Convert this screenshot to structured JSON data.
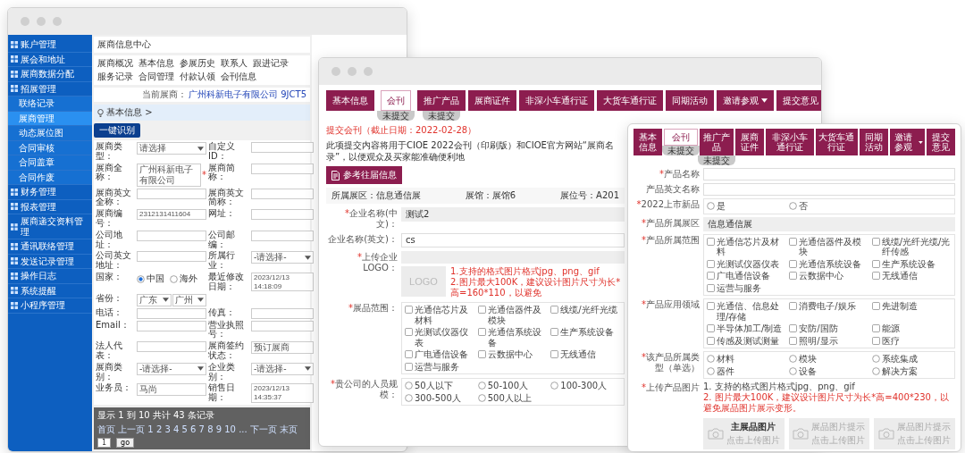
{
  "admin_window": {
    "sidebar": [
      {
        "label": "账户管理",
        "selected": false
      },
      {
        "label": "展会和地址",
        "selected": false
      },
      {
        "label": "展商数据分配",
        "selected": false
      },
      {
        "label": "招展管理",
        "selected": false,
        "children": [
          {
            "label": "联络记录",
            "selected": false
          },
          {
            "label": "展商管理",
            "selected": true
          },
          {
            "label": "动态展位图",
            "selected": false
          },
          {
            "label": "合同审核",
            "selected": false
          },
          {
            "label": "合同盖章",
            "selected": false
          },
          {
            "label": "合同作废",
            "selected": false
          }
        ]
      },
      {
        "label": "财务管理",
        "selected": false
      },
      {
        "label": "报表管理",
        "selected": false
      },
      {
        "label": "展商递交资料管理",
        "selected": false
      },
      {
        "label": "通讯联络管理",
        "selected": false
      },
      {
        "label": "发送记录管理",
        "selected": false
      },
      {
        "label": "操作日志",
        "selected": false
      },
      {
        "label": "系统提醒",
        "selected": false
      },
      {
        "label": "小程序管理",
        "selected": false
      }
    ],
    "page_title": "展商信息中心",
    "nav_links": [
      "展商概况",
      "基本信息",
      "参展历史",
      "联系人",
      "跟进记录",
      "服务记录",
      "合同管理",
      "付款认领",
      "会刊信息"
    ],
    "current_label": "当前展商：",
    "current_exhibitor": "广州科新电子有限公司 9JCT5",
    "breadcrumb": "基本信息 >",
    "action_button": "一键识别",
    "fields": [
      {
        "kind": "select",
        "label": "展商类型：",
        "value": "请选择"
      },
      {
        "kind": "input",
        "label": "自定义ID："
      },
      {
        "kind": "input",
        "label": "展商全称：",
        "value": "广州科新电子有限公司",
        "mark": "*"
      },
      {
        "kind": "input",
        "label": "展商简称："
      },
      {
        "kind": "input",
        "label": "展商英文全称："
      },
      {
        "kind": "input",
        "label": "展商英文简称："
      },
      {
        "kind": "input",
        "label": "展商编号：",
        "value": "2312131411604"
      },
      {
        "kind": "input",
        "label": "网址："
      },
      {
        "kind": "input",
        "label": "公司地址："
      },
      {
        "kind": "input",
        "label": "公司邮编："
      },
      {
        "kind": "input",
        "label": "公司英文地址："
      },
      {
        "kind": "select",
        "label": "所属行业：",
        "value": "-请选择-"
      },
      {
        "kind": "radio",
        "label": "国家：",
        "options": [
          {
            "label": "中国",
            "selected": true
          },
          {
            "label": "海外",
            "selected": false
          }
        ]
      },
      {
        "kind": "input",
        "label": "最近修改日期：",
        "value": "2023/12/13 14:18:09"
      },
      {
        "kind": "selects",
        "label": "省份：",
        "values": [
          "广东",
          "广州"
        ]
      },
      {
        "kind": "empty"
      },
      {
        "kind": "input",
        "label": "电话："
      },
      {
        "kind": "input",
        "label": "传真："
      },
      {
        "kind": "input",
        "label": "Email："
      },
      {
        "kind": "input",
        "label": "营业执照号："
      },
      {
        "kind": "input",
        "label": "法人代表："
      },
      {
        "kind": "input",
        "label": "展商签约状态：",
        "value": "预订展商"
      },
      {
        "kind": "select",
        "label": "展商类别：",
        "value": "-请选择-"
      },
      {
        "kind": "select",
        "label": "企业类别：",
        "value": "-请选择-"
      },
      {
        "kind": "input",
        "label": "业务员：",
        "value": "马尚"
      },
      {
        "kind": "input",
        "label": "销售日期：",
        "value": "2023/12/13 14:35:37"
      }
    ],
    "footer": {
      "summary": "显示 1 到 10 共计 43 条记录",
      "pager": "首页 上一页 1 2 3 4 5 6 7 8 9 10 ... 下一页 末页",
      "page": "1",
      "go": "go"
    }
  },
  "journal_window": {
    "tabs": [
      {
        "label": "基本信息",
        "selected": false
      },
      {
        "label": "会刊",
        "selected": true,
        "badge": "未提交"
      },
      {
        "label": "推广产品",
        "selected": false,
        "badge": "未提交"
      },
      {
        "label": "展商证件",
        "selected": false
      },
      {
        "label": "非深小车通行证",
        "selected": false
      },
      {
        "label": "大货车通行证",
        "selected": false
      },
      {
        "label": "同期活动",
        "selected": false
      },
      {
        "label": "邀请参观",
        "selected": false,
        "has_menu": true
      },
      {
        "label": "提交意见",
        "selected": false
      }
    ],
    "heading": "提交会刊（截止日期：2022-02-28）",
    "notice": "此项提交内容将用于CIOE 2022会刊（印刷版）和CIOE官方网站“展商名录”，以便观众及买家能准确便利地",
    "reference_button": "参考往届信息",
    "booth_info": [
      "所属展区：信息通信展",
      "展馆：展馆6",
      "展位号：A201"
    ],
    "rows": [
      {
        "kind": "input",
        "label": "企业名称(中文)：",
        "mark": "*",
        "value": "测试2",
        "filled": true
      },
      {
        "kind": "input",
        "label": "企业名称(英文)：",
        "value": "cs"
      },
      {
        "kind": "logo",
        "label": "上传企业LOGO：",
        "mark": "*",
        "placeholder": "LOGO",
        "hints": [
          {
            "text": "1.支持的格式图片格式jpg、png、gif",
            "warning": true
          },
          {
            "text": "2.图片最大100K，建议设计图片尺寸为长*高=160*110，以避免",
            "warning": true
          }
        ]
      },
      {
        "kind": "checks",
        "label": "展品范围：",
        "mark": "*",
        "options": [
          {
            "label": "光通信芯片及材料",
            "checked": false
          },
          {
            "label": "光通信器件及模块",
            "checked": false
          },
          {
            "label": "线缆/光纤光缆",
            "checked": false
          },
          {
            "label": "光测试仪器仪表",
            "checked": false
          },
          {
            "label": "光通信系统设备",
            "checked": false
          },
          {
            "label": "生产系统设备",
            "checked": false
          },
          {
            "label": "广电通信设备",
            "checked": false
          },
          {
            "label": "云数据中心",
            "checked": false
          },
          {
            "label": "无线通信",
            "checked": false
          },
          {
            "label": "运营与服务",
            "checked": false
          }
        ]
      },
      {
        "kind": "radios",
        "label": "贵公司的人员规模：",
        "mark": "*",
        "options": [
          {
            "label": "50人以下",
            "selected": false
          },
          {
            "label": "50-100人",
            "selected": false
          },
          {
            "label": "100-300人",
            "selected": false
          },
          {
            "label": "300-500人",
            "selected": false
          },
          {
            "label": "500人以上",
            "selected": false
          }
        ]
      }
    ]
  },
  "product_window": {
    "tabs": [
      {
        "label": "基本信息",
        "selected": false
      },
      {
        "label": "会刊",
        "selected": true,
        "badge": "未提交"
      },
      {
        "label": "推广产品",
        "selected": false,
        "badge": "未提交"
      },
      {
        "label": "展商证件",
        "selected": false
      },
      {
        "label": "非深小车通行证",
        "selected": false
      },
      {
        "label": "大货车通行证",
        "selected": false
      },
      {
        "label": "同期活动",
        "selected": false
      },
      {
        "label": "邀请参观",
        "selected": false,
        "has_menu": true
      },
      {
        "label": "提交意见",
        "selected": false
      }
    ],
    "rows": [
      {
        "kind": "input",
        "label": "产品名称",
        "mark": "*"
      },
      {
        "kind": "input",
        "label": "产品英文名称"
      },
      {
        "kind": "radios",
        "label": "2022上市新品",
        "mark": "*",
        "options": [
          {
            "label": "是",
            "selected": false
          },
          {
            "label": "否",
            "selected": false
          }
        ]
      },
      {
        "kind": "input",
        "label": "产品所属展区",
        "mark": "*",
        "value": "信息通信展",
        "filled": true
      },
      {
        "kind": "checks",
        "label": "产品所属范围",
        "mark": "*",
        "options": [
          {
            "label": "光通信芯片及材料",
            "checked": false
          },
          {
            "label": "光通信器件及模块",
            "checked": false
          },
          {
            "label": "线缆/光纤光缆/光纤传感",
            "checked": false
          },
          {
            "label": "光测试仪器仪表",
            "checked": false
          },
          {
            "label": "光通信系统设备",
            "checked": false
          },
          {
            "label": "生产系统设备",
            "checked": false
          },
          {
            "label": "广电通信设备",
            "checked": false
          },
          {
            "label": "云数据中心",
            "checked": false
          },
          {
            "label": "无线通信",
            "checked": false
          },
          {
            "label": "运营与服务",
            "checked": false
          }
        ]
      },
      {
        "kind": "checks",
        "label": "产品应用领域",
        "mark": "*",
        "options": [
          {
            "label": "光通信、信息处理/存储",
            "checked": false
          },
          {
            "label": "消费电子/娱乐",
            "checked": false
          },
          {
            "label": "先进制造",
            "checked": false
          },
          {
            "label": "半导体加工/制造",
            "checked": false
          },
          {
            "label": "安防/国防",
            "checked": false
          },
          {
            "label": "能源",
            "checked": false
          },
          {
            "label": "传感及测试测量",
            "checked": false
          },
          {
            "label": "照明/显示",
            "checked": false
          },
          {
            "label": "医疗",
            "checked": false
          }
        ]
      },
      {
        "kind": "radios",
        "label": "该产品所属类型（单选）",
        "mark": "*",
        "options": [
          {
            "label": "材料",
            "selected": false
          },
          {
            "label": "模块",
            "selected": false
          },
          {
            "label": "系统集成",
            "selected": false
          },
          {
            "label": "器件",
            "selected": false
          },
          {
            "label": "设备",
            "selected": false
          },
          {
            "label": "解决方案",
            "selected": false
          }
        ]
      },
      {
        "kind": "images",
        "label": "上传产品图片",
        "mark": "*",
        "hints": [
          {
            "text": "1. 支持的格式图片格式jpg、png、gif",
            "warning": false
          },
          {
            "text": "2. 图片最大100K，建议设计图片尺寸为长*高=400*230，以避免展品图片展示变形。",
            "warning": true
          }
        ],
        "slots": [
          {
            "title": "主展品图片",
            "primary": true,
            "action": "点击上传图片"
          },
          {
            "title": "展品图片提示",
            "primary": false,
            "action": "点击上传图片"
          },
          {
            "title": "展品图片提示",
            "primary": false,
            "action": "点击上传图片"
          }
        ]
      }
    ]
  }
}
